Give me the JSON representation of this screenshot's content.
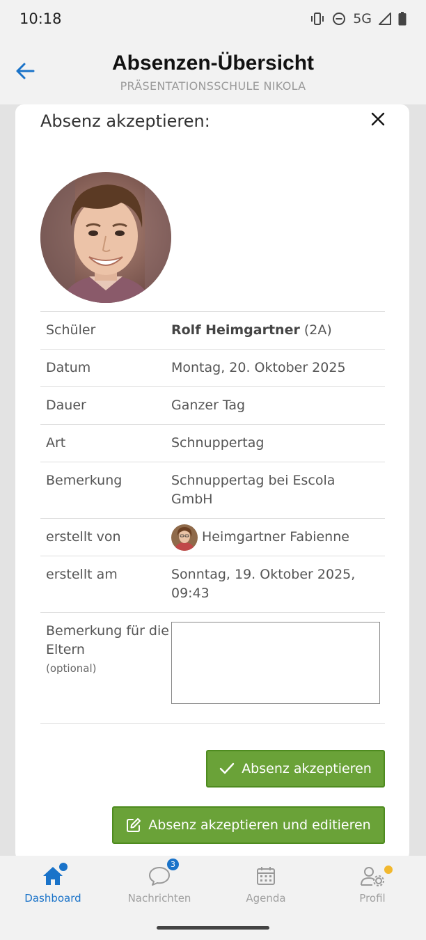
{
  "status_bar": {
    "time": "10:18",
    "network": "5G",
    "icons": [
      "vibrate-icon",
      "do-not-disturb-icon",
      "signal-icon",
      "battery-icon"
    ]
  },
  "header": {
    "title": "Absenzen-Übersicht",
    "subtitle": "PRÄSENTATIONSSCHULE NIKOLA",
    "back_icon": "arrow-left-icon"
  },
  "modal": {
    "title": "Absenz akzeptieren:",
    "close_icon": "close-icon",
    "student_photo": "student-photo",
    "rows": {
      "student": {
        "label": "Schüler",
        "name": "Rolf Heimgartner",
        "class": "(2A)"
      },
      "date": {
        "label": "Datum",
        "value": "Montag, 20. Oktober 2025"
      },
      "duration": {
        "label": "Dauer",
        "value": "Ganzer Tag"
      },
      "type": {
        "label": "Art",
        "value": "Schnuppertag"
      },
      "remark": {
        "label": "Bemerkung",
        "value": "Schnuppertag bei Escola GmbH"
      },
      "created_by": {
        "label": "erstellt von",
        "value": "Heimgartner Fabienne"
      },
      "created_at": {
        "label": "erstellt am",
        "value": "Sonntag, 19. Oktober 2025, 09:43"
      },
      "parent_note": {
        "label": "Bemerkung für die Eltern",
        "hint": "(optional)",
        "value": ""
      }
    },
    "buttons": {
      "accept": "Absenz akzeptieren",
      "accept_edit": "Absenz akzeptieren und editieren"
    }
  },
  "colors": {
    "accent": "#1a73c9",
    "button_green": "#6aa238",
    "notification_yellow": "#f2b82e"
  },
  "bottom_nav": {
    "items": [
      {
        "label": "Dashboard",
        "icon": "home-icon",
        "active": true
      },
      {
        "label": "Nachrichten",
        "icon": "chat-icon",
        "badge": "3"
      },
      {
        "label": "Agenda",
        "icon": "calendar-icon"
      },
      {
        "label": "Profil",
        "icon": "profile-settings-icon"
      }
    ]
  }
}
